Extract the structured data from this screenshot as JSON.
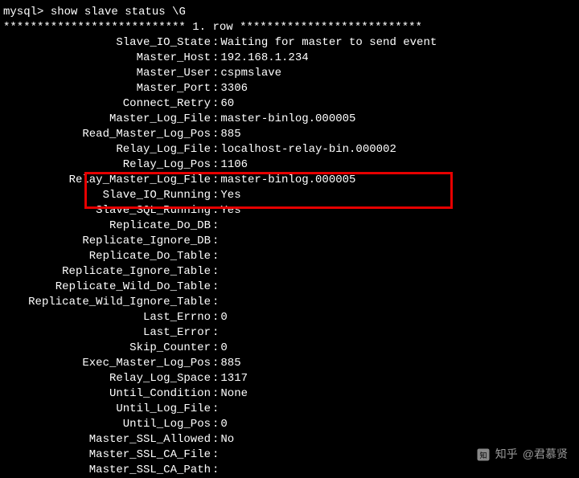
{
  "prompt": "mysql> ",
  "command": "show slave status \\G",
  "row_header": {
    "stars_left": "***************************",
    "label": "1. row",
    "stars_right": "***************************"
  },
  "status": [
    {
      "label": "Slave_IO_State",
      "value": "Waiting for master to send event"
    },
    {
      "label": "Master_Host",
      "value": "192.168.1.234"
    },
    {
      "label": "Master_User",
      "value": "cspmslave"
    },
    {
      "label": "Master_Port",
      "value": "3306"
    },
    {
      "label": "Connect_Retry",
      "value": "60"
    },
    {
      "label": "Master_Log_File",
      "value": "master-binlog.000005"
    },
    {
      "label": "Read_Master_Log_Pos",
      "value": "885"
    },
    {
      "label": "Relay_Log_File",
      "value": "localhost-relay-bin.000002"
    },
    {
      "label": "Relay_Log_Pos",
      "value": "1106"
    },
    {
      "label": "Relay_Master_Log_File",
      "value": "master-binlog.000005"
    },
    {
      "label": "Slave_IO_Running",
      "value": "Yes"
    },
    {
      "label": "Slave_SQL_Running",
      "value": "Yes"
    },
    {
      "label": "Replicate_Do_DB",
      "value": ""
    },
    {
      "label": "Replicate_Ignore_DB",
      "value": ""
    },
    {
      "label": "Replicate_Do_Table",
      "value": ""
    },
    {
      "label": "Replicate_Ignore_Table",
      "value": ""
    },
    {
      "label": "Replicate_Wild_Do_Table",
      "value": ""
    },
    {
      "label": "Replicate_Wild_Ignore_Table",
      "value": ""
    },
    {
      "label": "Last_Errno",
      "value": "0"
    },
    {
      "label": "Last_Error",
      "value": ""
    },
    {
      "label": "Skip_Counter",
      "value": "0"
    },
    {
      "label": "Exec_Master_Log_Pos",
      "value": "885"
    },
    {
      "label": "Relay_Log_Space",
      "value": "1317"
    },
    {
      "label": "Until_Condition",
      "value": "None"
    },
    {
      "label": "Until_Log_File",
      "value": ""
    },
    {
      "label": "Until_Log_Pos",
      "value": "0"
    },
    {
      "label": "Master_SSL_Allowed",
      "value": "No"
    },
    {
      "label": "Master_SSL_CA_File",
      "value": ""
    },
    {
      "label": "Master_SSL_CA_Path",
      "value": ""
    }
  ],
  "watermark": {
    "site": "知乎",
    "author": "@君慕贤"
  }
}
